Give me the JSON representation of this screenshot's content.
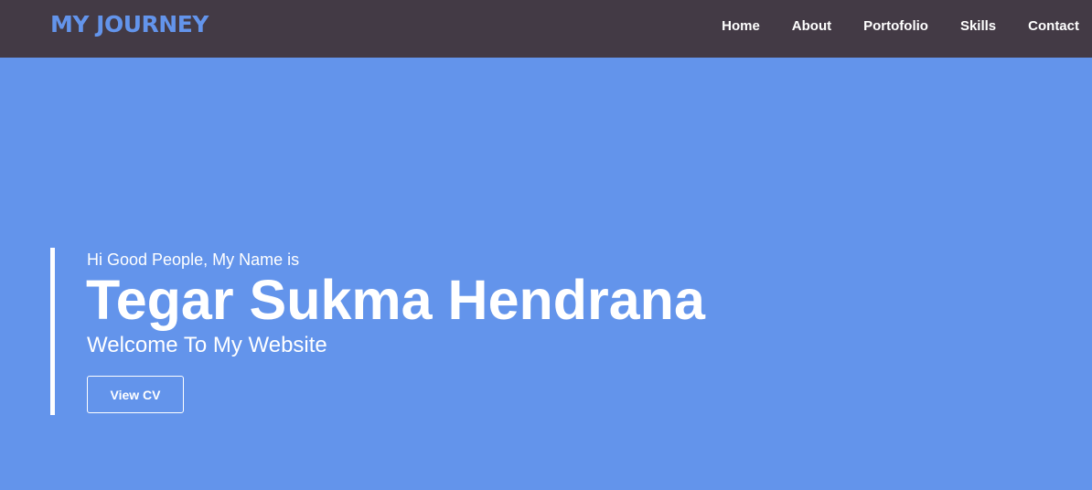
{
  "navbar": {
    "brand": "MY JOURNEY",
    "links": [
      {
        "label": "Home"
      },
      {
        "label": "About"
      },
      {
        "label": "Portofolio"
      },
      {
        "label": "Skills"
      },
      {
        "label": "Contact"
      }
    ]
  },
  "hero": {
    "greeting": "Hi Good People, My Name is",
    "name": "Tegar Sukma Hendrana",
    "welcome": "Welcome To My Website",
    "cv_button": "View CV"
  },
  "colors": {
    "background": "#6394eb",
    "navbar": "#433a45",
    "brand": "#6394eb",
    "text": "#ffffff"
  }
}
